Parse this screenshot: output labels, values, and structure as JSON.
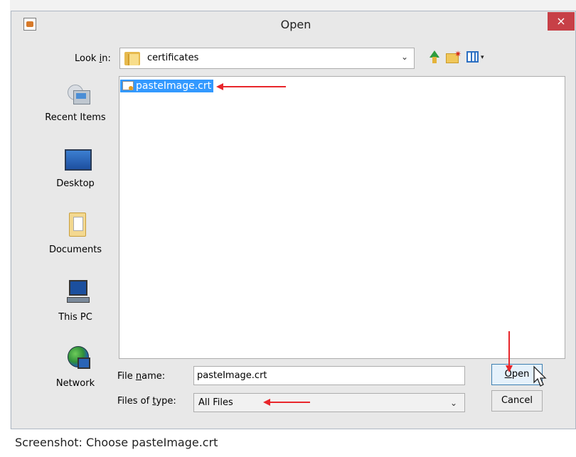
{
  "dialog": {
    "title": "Open",
    "close_symbol": "×",
    "look_in": {
      "label": "Look in:",
      "value": "certificates",
      "icon": "folder-icon"
    },
    "toolbar": [
      {
        "name": "up-one-level",
        "icon": "folder-up-icon"
      },
      {
        "name": "create-new-folder",
        "icon": "new-folder-icon"
      },
      {
        "name": "view-menu",
        "icon": "view-menu-icon"
      }
    ],
    "places": [
      {
        "label": "Recent Items",
        "icon": "recent-items-icon"
      },
      {
        "label": "Desktop",
        "icon": "desktop-icon"
      },
      {
        "label": "Documents",
        "icon": "documents-icon"
      },
      {
        "label": "This PC",
        "icon": "this-pc-icon"
      },
      {
        "label": "Network",
        "icon": "network-icon"
      }
    ],
    "files": [
      {
        "name": "pasteImage.crt",
        "icon": "certificate-file-icon",
        "selected": true
      }
    ],
    "file_name": {
      "label": "File name:",
      "value": "pasteImage.crt"
    },
    "files_of_type": {
      "label": "Files of type:",
      "value": "All Files"
    },
    "buttons": {
      "open": "Open",
      "cancel": "Cancel"
    }
  },
  "annotations": {
    "arrow_color": "#e8262b"
  },
  "colors": {
    "selection": "#3399ff",
    "close": "#c74047"
  },
  "caption": "Screenshot: Choose pasteImage.crt"
}
